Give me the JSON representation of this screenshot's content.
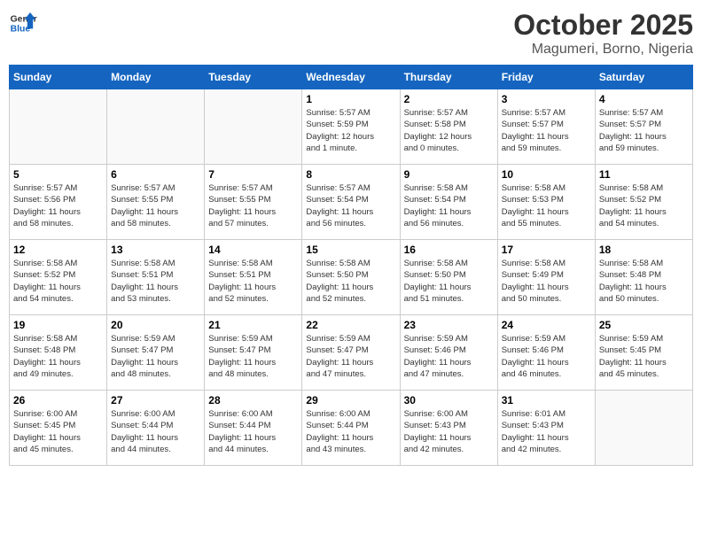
{
  "header": {
    "logo_line1": "General",
    "logo_line2": "Blue",
    "month": "October 2025",
    "location": "Magumeri, Borno, Nigeria"
  },
  "weekdays": [
    "Sunday",
    "Monday",
    "Tuesday",
    "Wednesday",
    "Thursday",
    "Friday",
    "Saturday"
  ],
  "weeks": [
    [
      {
        "day": "",
        "info": ""
      },
      {
        "day": "",
        "info": ""
      },
      {
        "day": "",
        "info": ""
      },
      {
        "day": "1",
        "info": "Sunrise: 5:57 AM\nSunset: 5:59 PM\nDaylight: 12 hours\nand 1 minute."
      },
      {
        "day": "2",
        "info": "Sunrise: 5:57 AM\nSunset: 5:58 PM\nDaylight: 12 hours\nand 0 minutes."
      },
      {
        "day": "3",
        "info": "Sunrise: 5:57 AM\nSunset: 5:57 PM\nDaylight: 11 hours\nand 59 minutes."
      },
      {
        "day": "4",
        "info": "Sunrise: 5:57 AM\nSunset: 5:57 PM\nDaylight: 11 hours\nand 59 minutes."
      }
    ],
    [
      {
        "day": "5",
        "info": "Sunrise: 5:57 AM\nSunset: 5:56 PM\nDaylight: 11 hours\nand 58 minutes."
      },
      {
        "day": "6",
        "info": "Sunrise: 5:57 AM\nSunset: 5:55 PM\nDaylight: 11 hours\nand 58 minutes."
      },
      {
        "day": "7",
        "info": "Sunrise: 5:57 AM\nSunset: 5:55 PM\nDaylight: 11 hours\nand 57 minutes."
      },
      {
        "day": "8",
        "info": "Sunrise: 5:57 AM\nSunset: 5:54 PM\nDaylight: 11 hours\nand 56 minutes."
      },
      {
        "day": "9",
        "info": "Sunrise: 5:58 AM\nSunset: 5:54 PM\nDaylight: 11 hours\nand 56 minutes."
      },
      {
        "day": "10",
        "info": "Sunrise: 5:58 AM\nSunset: 5:53 PM\nDaylight: 11 hours\nand 55 minutes."
      },
      {
        "day": "11",
        "info": "Sunrise: 5:58 AM\nSunset: 5:52 PM\nDaylight: 11 hours\nand 54 minutes."
      }
    ],
    [
      {
        "day": "12",
        "info": "Sunrise: 5:58 AM\nSunset: 5:52 PM\nDaylight: 11 hours\nand 54 minutes."
      },
      {
        "day": "13",
        "info": "Sunrise: 5:58 AM\nSunset: 5:51 PM\nDaylight: 11 hours\nand 53 minutes."
      },
      {
        "day": "14",
        "info": "Sunrise: 5:58 AM\nSunset: 5:51 PM\nDaylight: 11 hours\nand 52 minutes."
      },
      {
        "day": "15",
        "info": "Sunrise: 5:58 AM\nSunset: 5:50 PM\nDaylight: 11 hours\nand 52 minutes."
      },
      {
        "day": "16",
        "info": "Sunrise: 5:58 AM\nSunset: 5:50 PM\nDaylight: 11 hours\nand 51 minutes."
      },
      {
        "day": "17",
        "info": "Sunrise: 5:58 AM\nSunset: 5:49 PM\nDaylight: 11 hours\nand 50 minutes."
      },
      {
        "day": "18",
        "info": "Sunrise: 5:58 AM\nSunset: 5:48 PM\nDaylight: 11 hours\nand 50 minutes."
      }
    ],
    [
      {
        "day": "19",
        "info": "Sunrise: 5:58 AM\nSunset: 5:48 PM\nDaylight: 11 hours\nand 49 minutes."
      },
      {
        "day": "20",
        "info": "Sunrise: 5:59 AM\nSunset: 5:47 PM\nDaylight: 11 hours\nand 48 minutes."
      },
      {
        "day": "21",
        "info": "Sunrise: 5:59 AM\nSunset: 5:47 PM\nDaylight: 11 hours\nand 48 minutes."
      },
      {
        "day": "22",
        "info": "Sunrise: 5:59 AM\nSunset: 5:47 PM\nDaylight: 11 hours\nand 47 minutes."
      },
      {
        "day": "23",
        "info": "Sunrise: 5:59 AM\nSunset: 5:46 PM\nDaylight: 11 hours\nand 47 minutes."
      },
      {
        "day": "24",
        "info": "Sunrise: 5:59 AM\nSunset: 5:46 PM\nDaylight: 11 hours\nand 46 minutes."
      },
      {
        "day": "25",
        "info": "Sunrise: 5:59 AM\nSunset: 5:45 PM\nDaylight: 11 hours\nand 45 minutes."
      }
    ],
    [
      {
        "day": "26",
        "info": "Sunrise: 6:00 AM\nSunset: 5:45 PM\nDaylight: 11 hours\nand 45 minutes."
      },
      {
        "day": "27",
        "info": "Sunrise: 6:00 AM\nSunset: 5:44 PM\nDaylight: 11 hours\nand 44 minutes."
      },
      {
        "day": "28",
        "info": "Sunrise: 6:00 AM\nSunset: 5:44 PM\nDaylight: 11 hours\nand 44 minutes."
      },
      {
        "day": "29",
        "info": "Sunrise: 6:00 AM\nSunset: 5:44 PM\nDaylight: 11 hours\nand 43 minutes."
      },
      {
        "day": "30",
        "info": "Sunrise: 6:00 AM\nSunset: 5:43 PM\nDaylight: 11 hours\nand 42 minutes."
      },
      {
        "day": "31",
        "info": "Sunrise: 6:01 AM\nSunset: 5:43 PM\nDaylight: 11 hours\nand 42 minutes."
      },
      {
        "day": "",
        "info": ""
      }
    ]
  ]
}
